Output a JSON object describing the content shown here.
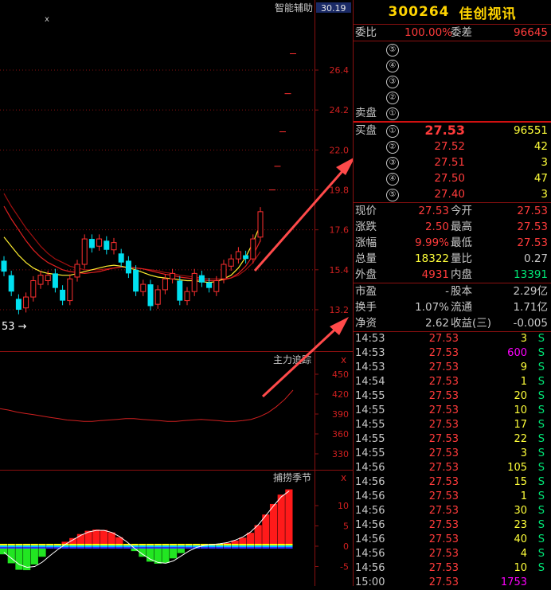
{
  "chart": {
    "indicator1": {
      "title": "智能辅助",
      "value": "30.19",
      "y_labels": [
        "26.4",
        "24.2",
        "22.0",
        "19.8",
        "17.6",
        "15.4",
        "13.2"
      ],
      "low_marker": "53"
    },
    "indicator2": {
      "title": "主力追踪",
      "close_icon": "x",
      "y_labels": [
        "450",
        "420",
        "390",
        "360",
        "330"
      ]
    },
    "indicator3": {
      "title": "捕捞季节",
      "close_icon": "x",
      "y_labels": [
        "10",
        "5",
        "0",
        "-5"
      ]
    },
    "top_close_icon": "x"
  },
  "quote": {
    "code": "300264",
    "name": "佳创视讯",
    "weibi_label": "委比",
    "weibi_value": "100.00%",
    "weicha_label": "委差",
    "weicha_value": "96645",
    "sell_label": "卖盘",
    "sell_levels": [
      "⑤",
      "④",
      "③",
      "②",
      "①"
    ],
    "buy_label": "买盘",
    "buy_levels": [
      {
        "num": "①",
        "price": "27.53",
        "vol": "96551"
      },
      {
        "num": "②",
        "price": "27.52",
        "vol": "42"
      },
      {
        "num": "③",
        "price": "27.51",
        "vol": "3"
      },
      {
        "num": "④",
        "price": "27.50",
        "vol": "47"
      },
      {
        "num": "⑤",
        "price": "27.40",
        "vol": "3"
      }
    ],
    "stats": [
      {
        "l1": "现价",
        "v1": "27.53",
        "c1": "red",
        "l2": "今开",
        "v2": "27.53",
        "c2": "red"
      },
      {
        "l1": "涨跌",
        "v1": "2.50",
        "c1": "red",
        "l2": "最高",
        "v2": "27.53",
        "c2": "red"
      },
      {
        "l1": "涨幅",
        "v1": "9.99%",
        "c1": "red",
        "l2": "最低",
        "v2": "27.53",
        "c2": "red"
      },
      {
        "l1": "总量",
        "v1": "18322",
        "c1": "yel",
        "l2": "量比",
        "v2": "0.27",
        "c2": "lbl"
      },
      {
        "l1": "外盘",
        "v1": "4931",
        "c1": "red",
        "l2": "内盘",
        "v2": "13391",
        "c2": "grn"
      }
    ],
    "fund": [
      {
        "l1": "市盈",
        "v1": "-",
        "l2": "股本",
        "v2": "2.29亿"
      },
      {
        "l1": "换手",
        "v1": "1.07%",
        "l2": "流通",
        "v2": "1.71亿"
      },
      {
        "l1": "净资",
        "v1": "2.62",
        "l2": "收益(三)",
        "v2": "-0.005"
      }
    ],
    "ticks": [
      {
        "t": "14:53",
        "p": "27.53",
        "v": "3",
        "vc": "yel",
        "s": "S"
      },
      {
        "t": "14:53",
        "p": "27.53",
        "v": "600",
        "vc": "mag",
        "s": "S"
      },
      {
        "t": "14:53",
        "p": "27.53",
        "v": "9",
        "vc": "yel",
        "s": "S"
      },
      {
        "t": "14:54",
        "p": "27.53",
        "v": "1",
        "vc": "yel",
        "s": "S"
      },
      {
        "t": "14:55",
        "p": "27.53",
        "v": "20",
        "vc": "yel",
        "s": "S"
      },
      {
        "t": "14:55",
        "p": "27.53",
        "v": "10",
        "vc": "yel",
        "s": "S"
      },
      {
        "t": "14:55",
        "p": "27.53",
        "v": "17",
        "vc": "yel",
        "s": "S"
      },
      {
        "t": "14:55",
        "p": "27.53",
        "v": "22",
        "vc": "yel",
        "s": "S"
      },
      {
        "t": "14:55",
        "p": "27.53",
        "v": "3",
        "vc": "yel",
        "s": "S"
      },
      {
        "t": "14:56",
        "p": "27.53",
        "v": "105",
        "vc": "yel",
        "s": "S"
      },
      {
        "t": "14:56",
        "p": "27.53",
        "v": "15",
        "vc": "yel",
        "s": "S"
      },
      {
        "t": "14:56",
        "p": "27.53",
        "v": "1",
        "vc": "yel",
        "s": "S"
      },
      {
        "t": "14:56",
        "p": "27.53",
        "v": "30",
        "vc": "yel",
        "s": "S"
      },
      {
        "t": "14:56",
        "p": "27.53",
        "v": "23",
        "vc": "yel",
        "s": "S"
      },
      {
        "t": "14:56",
        "p": "27.53",
        "v": "40",
        "vc": "yel",
        "s": "S"
      },
      {
        "t": "14:56",
        "p": "27.53",
        "v": "4",
        "vc": "yel",
        "s": "S"
      },
      {
        "t": "14:56",
        "p": "27.53",
        "v": "10",
        "vc": "yel",
        "s": "S"
      },
      {
        "t": "15:00",
        "p": "27.53",
        "v": "1753",
        "vc": "mag",
        "s": ""
      }
    ]
  },
  "chart_data": {
    "type": "candlestick",
    "y_range": [
      13.2,
      26.4
    ],
    "candles": [
      {
        "o": 15.9,
        "c": 15.3
      },
      {
        "o": 15.1,
        "c": 14.2
      },
      {
        "o": 13.8,
        "c": 13.2
      },
      {
        "o": 13.3,
        "c": 13.9
      },
      {
        "o": 13.9,
        "c": 14.8
      },
      {
        "o": 14.6,
        "c": 15.1
      },
      {
        "o": 14.8,
        "c": 15.1
      },
      {
        "o": 15.2,
        "c": 14.4
      },
      {
        "o": 14.3,
        "c": 13.7
      },
      {
        "o": 13.7,
        "c": 14.9
      },
      {
        "o": 15.0,
        "c": 15.7
      },
      {
        "o": 15.7,
        "c": 17.1
      },
      {
        "o": 17.1,
        "c": 16.6
      },
      {
        "o": 16.7,
        "c": 17.1
      },
      {
        "o": 17.0,
        "c": 16.5
      },
      {
        "o": 16.5,
        "c": 16.9
      },
      {
        "o": 16.3,
        "c": 15.8
      },
      {
        "o": 15.9,
        "c": 15.2
      },
      {
        "o": 15.4,
        "c": 14.2
      },
      {
        "o": 14.2,
        "c": 14.6
      },
      {
        "o": 14.6,
        "c": 13.4
      },
      {
        "o": 13.5,
        "c": 14.3
      },
      {
        "o": 14.3,
        "c": 14.9
      },
      {
        "o": 14.9,
        "c": 15.2
      },
      {
        "o": 14.8,
        "c": 13.7
      },
      {
        "o": 13.7,
        "c": 14.2
      },
      {
        "o": 14.2,
        "c": 15.2
      },
      {
        "o": 15.1,
        "c": 14.7
      },
      {
        "o": 14.7,
        "c": 14.4
      },
      {
        "o": 14.2,
        "c": 14.8
      },
      {
        "o": 14.9,
        "c": 15.7
      },
      {
        "o": 15.6,
        "c": 16.0
      },
      {
        "o": 16.0,
        "c": 16.4
      },
      {
        "o": 16.2,
        "c": 16.0
      },
      {
        "o": 16.0,
        "c": 17.1
      },
      {
        "o": 17.2,
        "c": 18.6
      }
    ],
    "dashes": [
      27.3,
      25.1,
      23.0,
      21.1,
      19.8
    ],
    "ma_yellow": [
      17.2,
      16.7,
      16.2,
      15.8,
      15.5,
      15.3,
      15.2,
      15.15,
      15.1,
      15.1,
      15.2,
      15.3,
      15.4,
      15.5,
      15.6,
      15.65,
      15.6,
      15.5,
      15.4,
      15.25,
      15.1,
      15.0,
      14.95,
      14.9,
      14.85,
      14.8,
      14.8,
      14.75,
      14.7,
      14.75,
      14.9,
      15.1,
      15.5,
      16.1,
      16.9,
      17.9
    ],
    "ma_red": [
      18.9,
      18.2,
      17.6,
      17.0,
      16.5,
      16.1,
      15.8,
      15.6,
      15.4,
      15.3,
      15.25,
      15.2,
      15.25,
      15.3,
      15.4,
      15.5,
      15.55,
      15.55,
      15.5,
      15.45,
      15.35,
      15.25,
      15.15,
      15.1,
      15.0,
      14.95,
      14.9,
      14.85,
      14.8,
      14.8,
      14.85,
      14.95,
      15.2,
      15.6,
      16.2,
      17.0
    ],
    "ma_red_dark": [
      19.6,
      18.9,
      18.3,
      17.7,
      17.2,
      16.7,
      16.3,
      16.0,
      15.8,
      15.6,
      15.5,
      15.4,
      15.4,
      15.4,
      15.45,
      15.5,
      15.55,
      15.55,
      15.5,
      15.45,
      15.4,
      15.35,
      15.25,
      15.2,
      15.1,
      15.05,
      15.0,
      14.95,
      14.9,
      14.9,
      14.9,
      14.95,
      15.1,
      15.4,
      15.8,
      16.4
    ],
    "mf_range": [
      330,
      460
    ],
    "main_force": [
      398,
      396,
      393,
      391,
      389,
      387,
      385,
      383,
      381,
      380,
      379,
      379,
      380,
      381,
      382,
      383,
      383,
      382,
      381,
      380,
      379,
      379,
      380,
      381,
      382,
      381,
      380,
      379,
      379,
      380,
      382,
      386,
      392,
      401,
      412,
      426
    ],
    "macd_range": [
      -7,
      14
    ],
    "macd": [
      -2,
      -4.2,
      -5.8,
      -5.9,
      -4.5,
      -2.6,
      -0.5,
      0.3,
      1.1,
      2.0,
      3.0,
      3.8,
      4.1,
      4.0,
      3.4,
      2.2,
      0.4,
      -1.2,
      -2.6,
      -3.8,
      -4.3,
      -4.1,
      -3.0,
      -1.7,
      -0.6,
      0.0,
      0.3,
      0.5,
      0.6,
      0.8,
      1.4,
      2.1,
      3.3,
      5.2,
      7.8,
      10.4,
      12.7,
      14.0
    ],
    "macd_line": [
      -1.5,
      -3.0,
      -4.5,
      -5.2,
      -5.0,
      -3.9,
      -2.3,
      -0.8,
      0.5,
      1.6,
      2.7,
      3.5,
      3.9,
      3.9,
      3.4,
      2.4,
      1.0,
      -0.6,
      -2.0,
      -3.2,
      -4.0,
      -4.2,
      -3.6,
      -2.4,
      -1.2,
      -0.3,
      0.2,
      0.4,
      0.6,
      0.9,
      1.5,
      2.3,
      3.5,
      5.3,
      7.6,
      10.0,
      12.2,
      13.6
    ]
  }
}
